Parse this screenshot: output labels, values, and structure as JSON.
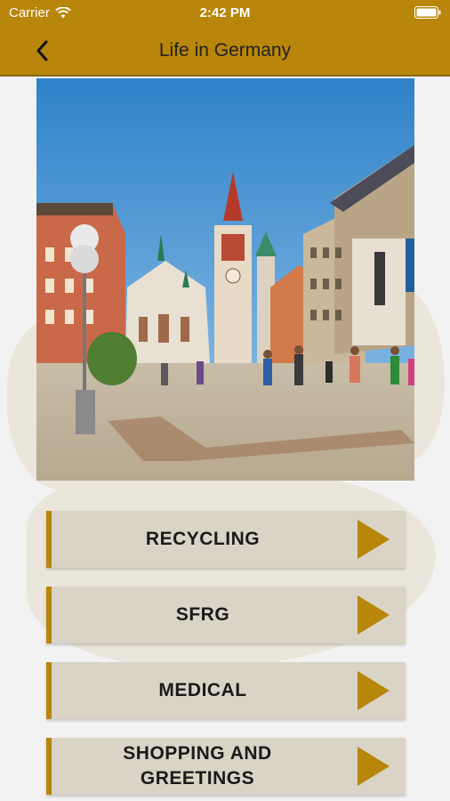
{
  "status_bar": {
    "carrier": "Carrier",
    "time": "2:42 PM",
    "icons": [
      "wifi-icon",
      "battery-icon"
    ]
  },
  "nav": {
    "title": "Life in Germany",
    "back_icon": "chevron-left-icon"
  },
  "hero_image": {
    "icon": "city-square-photo"
  },
  "menu": [
    {
      "label": "RECYCLING",
      "icon": "play-triangle-icon"
    },
    {
      "label": "SFRG",
      "icon": "play-triangle-icon"
    },
    {
      "label": "MEDICAL",
      "icon": "play-triangle-icon"
    },
    {
      "label": "SHOPPING AND GREETINGS",
      "icon": "play-triangle-icon"
    }
  ],
  "colors": {
    "header": "#b8860b",
    "button_bg": "#d9d4c6",
    "accent": "#b8860b",
    "background": "#f2f2f2"
  }
}
